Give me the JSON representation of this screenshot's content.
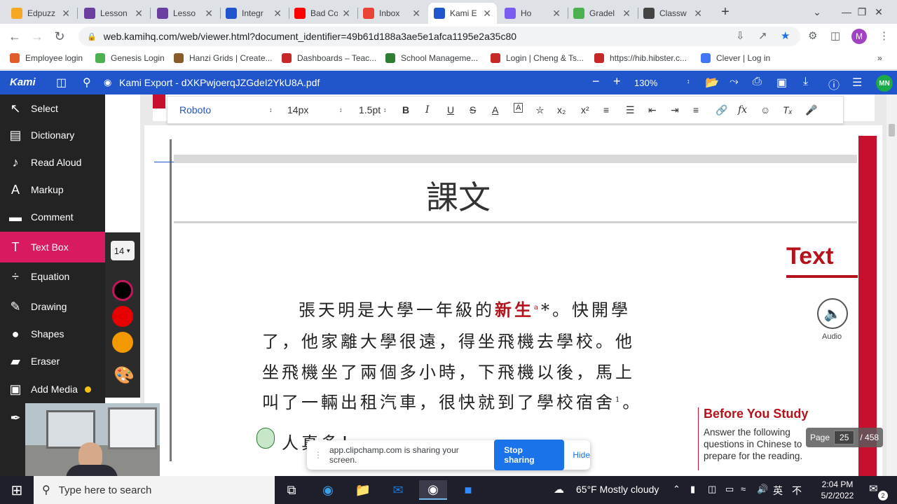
{
  "browser": {
    "tabs": [
      {
        "label": "Edpuzz",
        "icon": "edpuzzle-icon",
        "color": "#f7a823"
      },
      {
        "label": "Lesson",
        "icon": "lesson-icon",
        "color": "#6b3fa0"
      },
      {
        "label": "Lesso",
        "icon": "lesson-icon",
        "color": "#6b3fa0"
      },
      {
        "label": "Integr",
        "icon": "kami-icon",
        "color": "#2155cc"
      },
      {
        "label": "Bad Co",
        "icon": "youtube-icon",
        "color": "#ff0000"
      },
      {
        "label": "Inbox",
        "icon": "gmail-icon",
        "color": "#ea4335"
      },
      {
        "label": "Kami E",
        "icon": "kami-icon",
        "color": "#2155cc"
      },
      {
        "label": "Ho",
        "icon": "clipchamp-icon",
        "color": "#7b5cf0"
      },
      {
        "label": "Gradel",
        "icon": "genesis-icon",
        "color": "#4caf50"
      },
      {
        "label": "Classw",
        "icon": "classwork-icon",
        "color": "#444444"
      }
    ],
    "active_tab_index": 6,
    "url": "web.kamihq.com/web/viewer.html?document_identifier=49b61d188a3ae5e1afca1195e2a35c80",
    "profile_initial": "M",
    "bookmarks": [
      {
        "label": "Employee login",
        "color": "#e25c2b"
      },
      {
        "label": "Genesis Login",
        "color": "#4caf50"
      },
      {
        "label": "Hanzi Grids | Create...",
        "color": "#8b5a2b"
      },
      {
        "label": "Dashboards – Teac...",
        "color": "#c62828"
      },
      {
        "label": "School Manageme...",
        "color": "#2e7d32"
      },
      {
        "label": "Login | Cheng & Ts...",
        "color": "#c62828"
      },
      {
        "label": "https://hib.hibster.c...",
        "color": "#c62828"
      },
      {
        "label": "Clever | Log in",
        "color": "#4274f6"
      }
    ]
  },
  "kami": {
    "logo": "Kami",
    "doc_title": "Kami Export - dXKPwjoerqJZGdeI2YkU8A.pdf",
    "zoom": "130%",
    "avatar": "MN",
    "tools": [
      {
        "label": "Select",
        "icon": "cursor-icon"
      },
      {
        "label": "Dictionary",
        "icon": "book-icon"
      },
      {
        "label": "Read Aloud",
        "icon": "speaker-icon"
      },
      {
        "label": "Markup",
        "icon": "markup-icon"
      },
      {
        "label": "Comment",
        "icon": "comment-icon"
      },
      {
        "label": "Text Box",
        "icon": "textbox-icon"
      },
      {
        "label": "Equation",
        "icon": "divide-icon"
      },
      {
        "label": "Drawing",
        "icon": "brush-icon"
      },
      {
        "label": "Shapes",
        "icon": "shapes-icon"
      },
      {
        "label": "Eraser",
        "icon": "eraser-icon"
      },
      {
        "label": "Add Media",
        "icon": "image-icon"
      }
    ],
    "active_tool": "Text Box",
    "textbox_font_size": "14",
    "colors": [
      "#000000",
      "#e60000",
      "#f29900"
    ],
    "format": {
      "font": "Roboto",
      "size": "14px",
      "line": "1.5pt"
    }
  },
  "page": {
    "title": "課文",
    "section_label": "Text",
    "audio_label": "Audio",
    "lines": [
      {
        "before": "張天明是大學一年級的",
        "highlight": "新生",
        "after": "*。快開學",
        "note": "a"
      },
      {
        "before": "了，他家離大學很遠，得坐飛機去學校。他",
        "highlight": "",
        "after": ""
      },
      {
        "before": "坐飛機坐了兩個多小時，下飛機以後，馬上",
        "highlight": "",
        "after": ""
      },
      {
        "before": "叫了一輛出租汽車，很快就到了學校宿舍",
        "highlight": "",
        "after": "。",
        "note": "1"
      }
    ],
    "partial_line": "人真多！",
    "before_you_study_title": "Before You Study",
    "before_you_study_text": "Answer the following questions in Chinese to prepare for the reading.",
    "page_label": "Page",
    "page_current": "25",
    "page_total": "/ 458"
  },
  "share": {
    "message": "app.clipchamp.com is sharing your screen.",
    "stop_label": "Stop sharing",
    "hide_label": "Hide"
  },
  "taskbar": {
    "search_placeholder": "Type here to search",
    "weather": "65°F  Mostly cloudy",
    "ime": "英",
    "time": "2:04 PM",
    "date": "5/2/2022",
    "notifications": "2"
  }
}
